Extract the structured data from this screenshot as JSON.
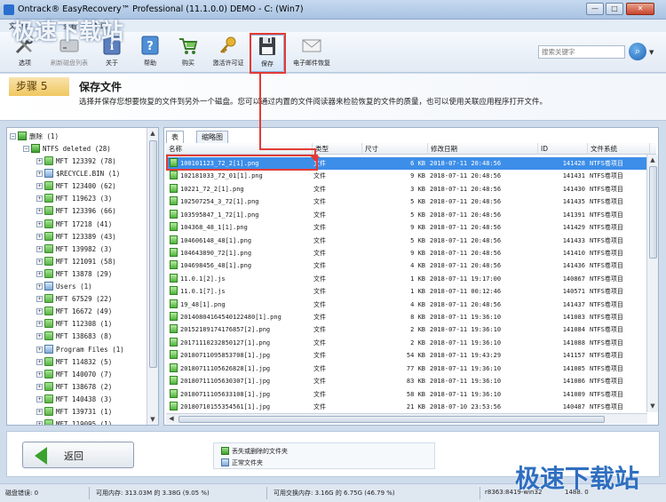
{
  "window": {
    "title": "Ontrack® EasyRecovery™ Professional (11.1.0.0) DEMO - C: (Win7)",
    "min": "—",
    "max": "□",
    "close": "✕"
  },
  "menu": [
    "文",
    "件",
    "查看",
    "帮助"
  ],
  "toolbar": {
    "items": [
      {
        "label": "选项",
        "icon": "tools-icon"
      },
      {
        "label": "刷新磁盘列表",
        "icon": "disk-icon"
      },
      {
        "label": "关于",
        "icon": "info-icon"
      },
      {
        "label": "帮助",
        "icon": "help-icon"
      },
      {
        "label": "购买",
        "icon": "cart-icon"
      },
      {
        "label": "激活许可证",
        "icon": "key-icon"
      },
      {
        "label": "保存",
        "icon": "floppy-icon"
      },
      {
        "label": "电子邮件恢复",
        "icon": "email-icon"
      }
    ],
    "search_placeholder": "搜索关键字"
  },
  "step": {
    "badge": "步骤 5",
    "title": "保存文件",
    "description": "选择并保存您想要恢复的文件到另外一个磁盘。您可以通过内置的文件阅读器来检验恢复的文件的质量，也可以使用关联应用程序打开文件。"
  },
  "tree": {
    "root": "删除 (1)",
    "volume": "NTFS deleted (28)",
    "items": [
      "MFT 123392 (78)",
      "$RECYCLE.BIN (1)",
      "MFT 123400 (62)",
      "MFT 119623 (3)",
      "MFT 123396 (66)",
      "MFT 17218 (41)",
      "MFT 123389 (43)",
      "MFT 139982 (3)",
      "MFT 121091 (58)",
      "MFT 13878 (29)",
      "Users (1)",
      "MFT 67529 (22)",
      "MFT 16672 (49)",
      "MFT 112308 (1)",
      "MFT 138683 (8)",
      "Program Files (1)",
      "MFT 114832 (5)",
      "MFT 140070 (7)",
      "MFT 138678 (2)",
      "MFT 140438 (3)",
      "MFT 139731 (1)",
      "MFT 119095 (1)"
    ]
  },
  "tabs": [
    "表",
    "缩略图"
  ],
  "columns": [
    "名称",
    "类型",
    "尺寸",
    "修改日期",
    "ID",
    "文件系统"
  ],
  "files": [
    [
      "100101123_72_2[1].png",
      "文件",
      "6 KB",
      "2018-07-11 20:48:56",
      "141428",
      "NTFS卷项目"
    ],
    [
      "102181033_72_01[1].png",
      "文件",
      "9 KB",
      "2018-07-11 20:48:56",
      "141431",
      "NTFS卷项目"
    ],
    [
      "10221_72_2[1].png",
      "文件",
      "3 KB",
      "2018-07-11 20:48:56",
      "141430",
      "NTFS卷项目"
    ],
    [
      "102507254_3_72[1].png",
      "文件",
      "5 KB",
      "2018-07-11 20:48:56",
      "141435",
      "NTFS卷项目"
    ],
    [
      "103595847_1_72[1].png",
      "文件",
      "5 KB",
      "2018-07-11 20:48:56",
      "141391",
      "NTFS卷项目"
    ],
    [
      "104368_48_1[1].png",
      "文件",
      "9 KB",
      "2018-07-11 20:48:56",
      "141429",
      "NTFS卷项目"
    ],
    [
      "104606148_48[1].png",
      "文件",
      "5 KB",
      "2018-07-11 20:48:56",
      "141433",
      "NTFS卷项目"
    ],
    [
      "104643890_72[1].png",
      "文件",
      "9 KB",
      "2018-07-11 20:48:56",
      "141410",
      "NTFS卷项目"
    ],
    [
      "104698456_48[1].png",
      "文件",
      "4 KB",
      "2018-07-11 20:48:56",
      "141436",
      "NTFS卷项目"
    ],
    [
      "11.0.1[2].js",
      "文件",
      "1 KB",
      "2018-07-11 19:17:00",
      "140867",
      "NTFS卷项目"
    ],
    [
      "11.0.1[7].js",
      "文件",
      "1 KB",
      "2018-07-11 00:12:46",
      "140571",
      "NTFS卷项目"
    ],
    [
      "19_48[1].png",
      "文件",
      "4 KB",
      "2018-07-11 20:48:56",
      "141437",
      "NTFS卷项目"
    ],
    [
      "20140804164540122480[1].png",
      "文件",
      "8 KB",
      "2018-07-11 19:36:10",
      "141083",
      "NTFS卷项目"
    ],
    [
      "20152189174176857[2].png",
      "文件",
      "2 KB",
      "2018-07-11 19:36:10",
      "141084",
      "NTFS卷项目"
    ],
    [
      "20171110232850127[1].png",
      "文件",
      "2 KB",
      "2018-07-11 19:36:10",
      "141088",
      "NTFS卷项目"
    ],
    [
      "20180711095853708[1].jpg",
      "文件",
      "54 KB",
      "2018-07-11 19:43:29",
      "141157",
      "NTFS卷项目"
    ],
    [
      "20180711105626828[1].jpg",
      "文件",
      "77 KB",
      "2018-07-11 19:36:10",
      "141085",
      "NTFS卷项目"
    ],
    [
      "20180711105630307[1].jpg",
      "文件",
      "83 KB",
      "2018-07-11 19:36:10",
      "141086",
      "NTFS卷项目"
    ],
    [
      "20180711105633108[1].jpg",
      "文件",
      "58 KB",
      "2018-07-11 19:36:10",
      "141089",
      "NTFS卷项目"
    ],
    [
      "20180710155354561[1].jpg",
      "文件",
      "21 KB",
      "2018-07-10 23:53:56",
      "140487",
      "NTFS卷项目"
    ]
  ],
  "back_button": "返回",
  "legend": [
    "丢失或删除的文件夹",
    "正常文件夹"
  ],
  "status": {
    "disk_errors": "磁盘错误: 0",
    "memory": "可用内存: 313.03M 的 3.38G (9.05 %)",
    "swap": "可用交换内存: 3.16G 的 6.75G (46.79 %)",
    "extra1": "r8363:8419-win32",
    "extra2": "1488. 0"
  },
  "watermark": "极速下载站",
  "colors": {
    "accent": "#3d8ee8",
    "annotation": "#e23b36",
    "step_badge": "#f0c761"
  }
}
